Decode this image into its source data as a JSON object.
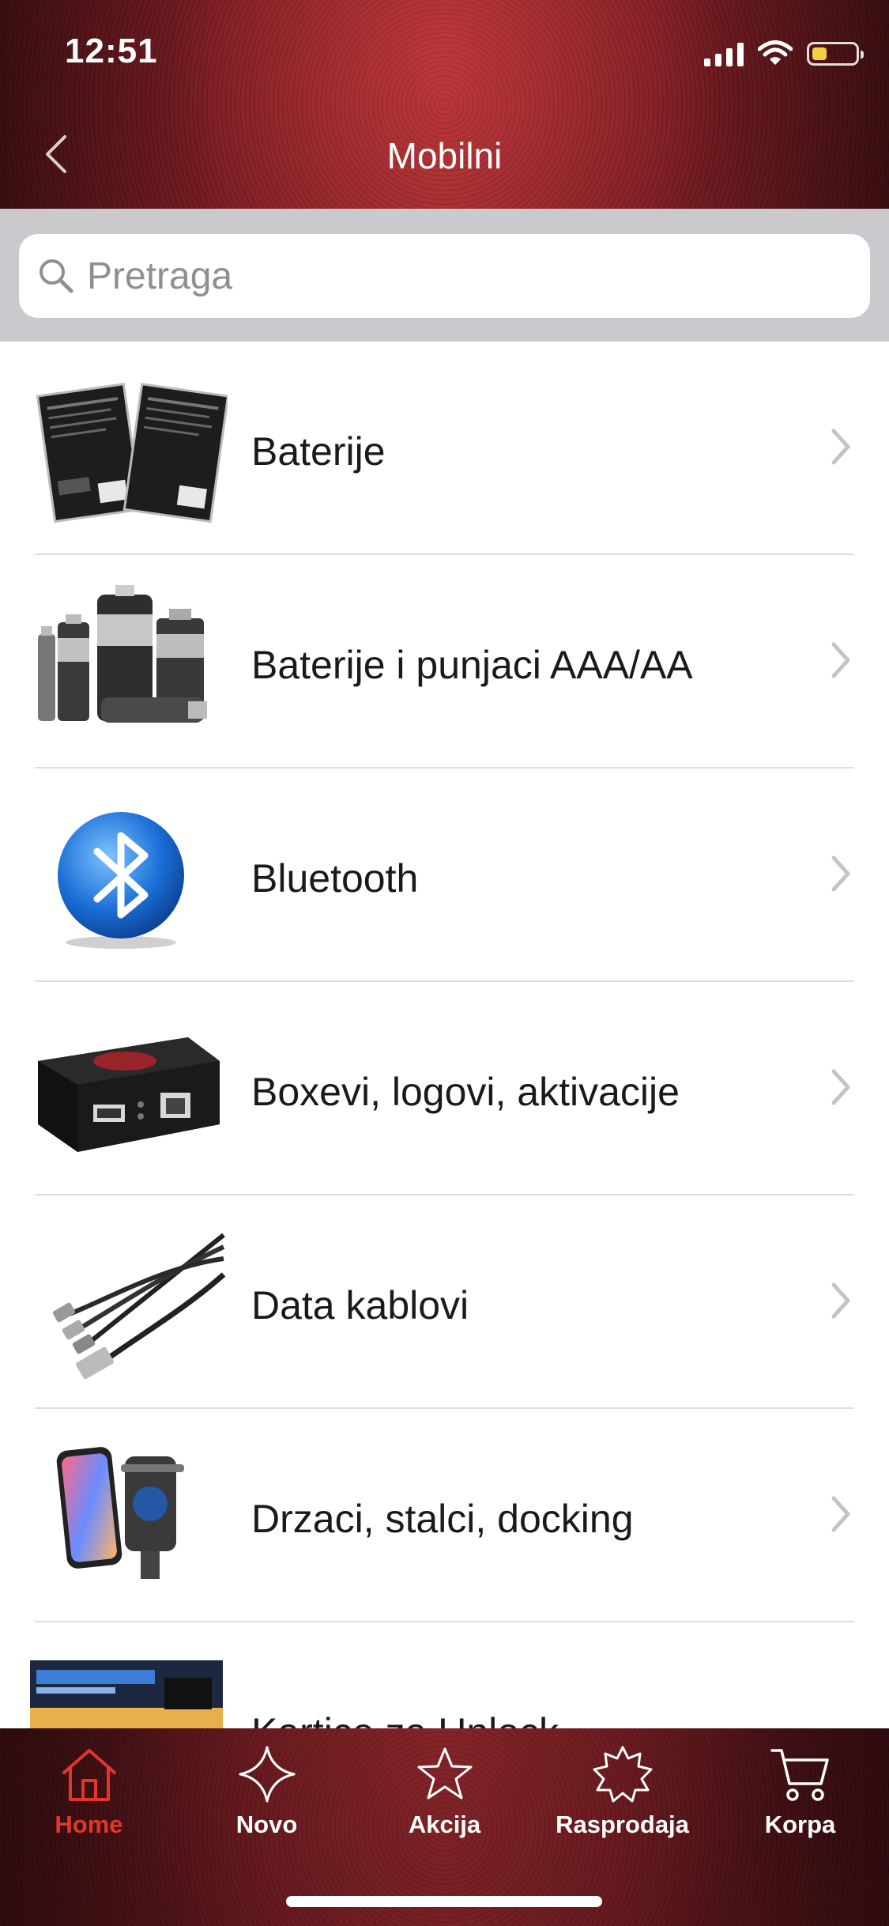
{
  "status_bar": {
    "time": "12:51"
  },
  "header": {
    "title": "Mobilni"
  },
  "search": {
    "placeholder": "Pretraga"
  },
  "categories": [
    {
      "label": "Baterije",
      "icon": "battery-packs-image"
    },
    {
      "label": "Baterije i punjaci AAA/AA",
      "icon": "aa-batteries-image"
    },
    {
      "label": "Bluetooth",
      "icon": "bluetooth-logo-image"
    },
    {
      "label": "Boxevi, logovi, aktivacije",
      "icon": "unlock-box-image"
    },
    {
      "label": "Data kablovi",
      "icon": "usb-cable-image"
    },
    {
      "label": "Drzaci, stalci, docking",
      "icon": "phone-holder-image"
    },
    {
      "label": "Kartice za Unlock",
      "icon": "sim-card-image"
    }
  ],
  "tabbar": {
    "tabs": [
      {
        "label": "Home",
        "icon": "home-icon",
        "active": true
      },
      {
        "label": "Novo",
        "icon": "four-point-star-icon",
        "active": false
      },
      {
        "label": "Akcija",
        "icon": "star-icon",
        "active": false
      },
      {
        "label": "Rasprodaja",
        "icon": "burst-star-icon",
        "active": false
      },
      {
        "label": "Korpa",
        "icon": "cart-icon",
        "active": false
      }
    ]
  },
  "colors": {
    "accent": "#e3352b",
    "header_red": "#9a2a2f",
    "search_bg": "#c9c9ce"
  }
}
